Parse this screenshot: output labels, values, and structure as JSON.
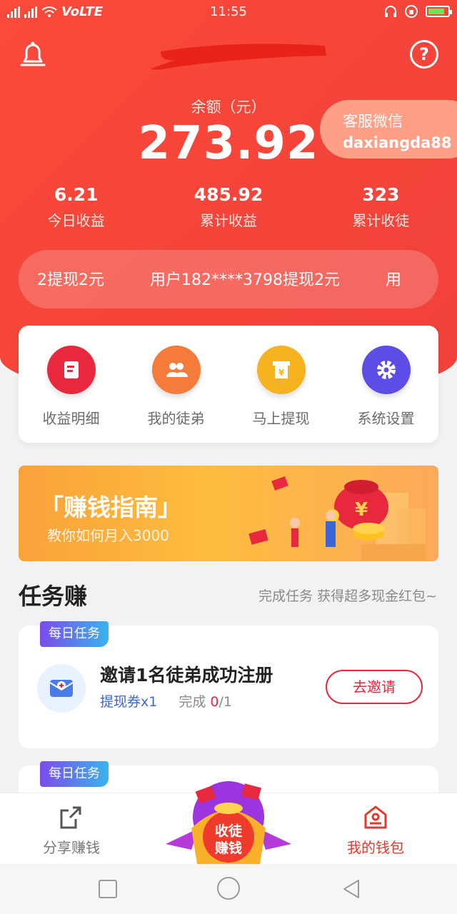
{
  "status_bar": {
    "network": "VoLTE",
    "time": "11:55"
  },
  "header": {
    "balance_label": "余额（元）",
    "balance_value": "273.92",
    "service_label": "客服微信",
    "service_id": "daxiangda88"
  },
  "stats": [
    {
      "value": "6.21",
      "label": "今日收益"
    },
    {
      "value": "485.92",
      "label": "累计收益"
    },
    {
      "value": "323",
      "label": "累计收徒"
    }
  ],
  "ticker": {
    "items": [
      "2提现2元",
      "用户182****3798提现2元",
      "用"
    ]
  },
  "menu": [
    {
      "label": "收益明细",
      "icon": "receipt-icon"
    },
    {
      "label": "我的徒弟",
      "icon": "people-icon"
    },
    {
      "label": "马上提现",
      "icon": "yen-box-icon"
    },
    {
      "label": "系统设置",
      "icon": "gear-icon"
    }
  ],
  "banner": {
    "title": "「赚钱指南」",
    "subtitle": "教你如何月入3000"
  },
  "tasks_section": {
    "title": "任务赚",
    "subtitle": "完成任务 获得超多现金红包~"
  },
  "tasks": [
    {
      "tag": "每日任务",
      "title": "邀请1名徒弟成功注册",
      "reward": "提现券x1",
      "progress_label": "完成",
      "progress_done": "0",
      "progress_total": "/1",
      "button": "去邀请"
    },
    {
      "tag": "每日任务"
    }
  ],
  "tabbar": {
    "share": "分享赚钱",
    "center_line1": "收徒",
    "center_line2": "赚钱",
    "wallet": "我的钱包"
  },
  "colors": {
    "primary_red": "#f6463a",
    "accent_red": "#e8283d",
    "link_blue": "#3b66d6"
  }
}
